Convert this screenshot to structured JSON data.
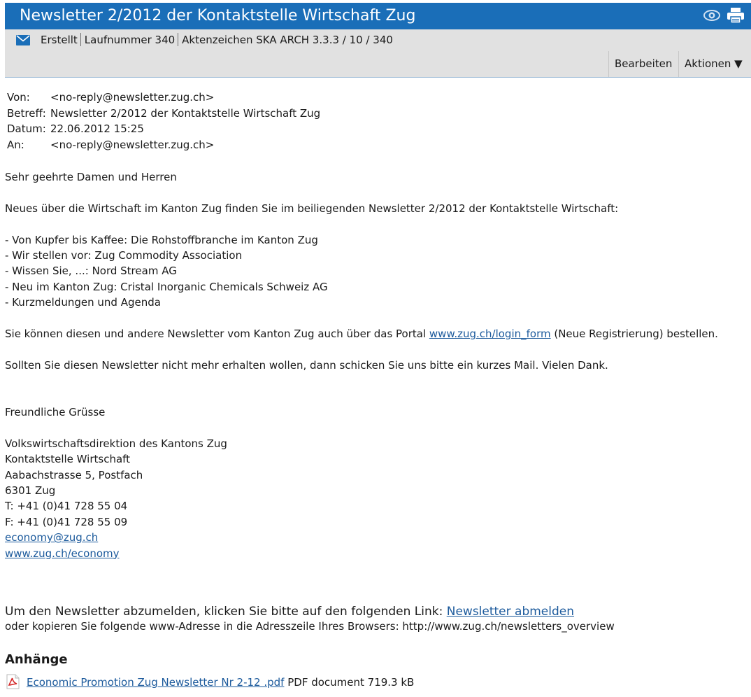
{
  "header": {
    "title": "Newsletter 2/2012 der Kontaktstelle Wirtschaft Zug",
    "icons": [
      "eye-icon",
      "printer-icon"
    ],
    "colors": {
      "title_bar": "#1a6eb8",
      "meta_bar": "#e1e1e1",
      "link": "#1c5a9c"
    }
  },
  "meta": {
    "icon": "mail-icon",
    "status": "Erstellt",
    "laufnummer": "Laufnummer 340",
    "aktenzeichen": "Aktenzeichen SKA ARCH 3.3.3 / 10 / 340"
  },
  "toolbar": {
    "edit_label": "Bearbeiten",
    "actions_label": "Aktionen ▼"
  },
  "email_headers": [
    {
      "label": "Von:",
      "value": "<no-reply@newsletter.zug.ch>"
    },
    {
      "label": "Betreff:",
      "value": "Newsletter 2/2012 der Kontaktstelle Wirtschaft Zug"
    },
    {
      "label": "Datum:",
      "value": "22.06.2012 15:25"
    },
    {
      "label": "An:",
      "value": "<no-reply@newsletter.zug.ch>"
    }
  ],
  "body": {
    "greeting": "Sehr geehrte Damen und Herren",
    "intro": "Neues über die Wirtschaft im Kanton Zug finden Sie im beiliegenden Newsletter 2/2012 der Kontaktstelle Wirtschaft:",
    "items": [
      "- Von Kupfer bis Kaffee: Die Rohstoffbranche im Kanton Zug",
      "- Wir stellen vor: Zug Commodity Association",
      "- Wissen Sie, ...: Nord Stream AG",
      "- Neu im Kanton Zug: Cristal Inorganic Chemicals Schweiz AG",
      "- Kurzmeldungen und Agenda"
    ],
    "portal_before": "Sie können diesen und andere Newsletter vom Kanton Zug auch über das Portal ",
    "portal_link": "www.zug.ch/login_form",
    "portal_after": " (Neue Registrierung) bestellen.",
    "unsubscribe_note": "Sollten Sie diesen Newsletter nicht mehr erhalten wollen, dann schicken Sie uns bitte ein kurzes Mail. Vielen Dank.",
    "closing": "Freundliche Grüsse",
    "signature": [
      "Volkswirtschaftsdirektion des Kantons Zug",
      "Kontaktstelle Wirtschaft",
      "Aabachstrasse 5, Postfach",
      "6301 Zug",
      "T: +41 (0)41 728 55 04",
      "F: +41 (0)41 728 55 09"
    ],
    "email_link": "economy@zug.ch",
    "web_link": "www.zug.ch/economy"
  },
  "unsubscribe": {
    "text": "Um den Newsletter abzumelden, klicken Sie bitte auf den folgenden Link: ",
    "link": "Newsletter abmelden",
    "copy_text": "oder kopieren Sie folgende www-Adresse in die Adresszeile Ihres Browsers: http://www.zug.ch/newsletters_overview"
  },
  "attachments": {
    "heading": "Anhänge",
    "files": [
      {
        "icon": "pdf-icon",
        "name": "Economic Promotion Zug Newsletter Nr 2-12 .pdf",
        "info": " PDF document 719.3 kB"
      }
    ]
  }
}
